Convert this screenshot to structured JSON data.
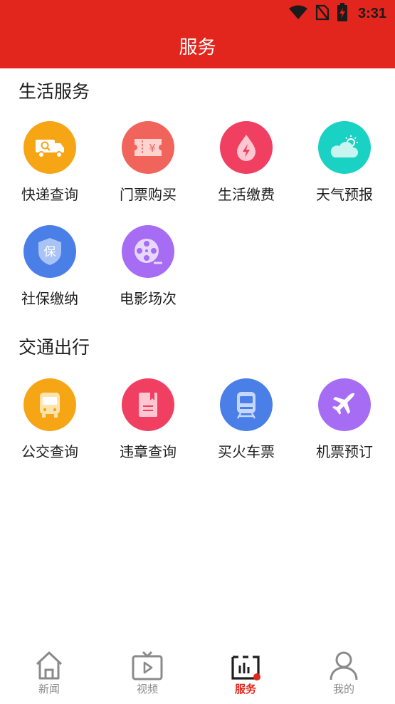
{
  "status_bar": {
    "time": "3:31"
  },
  "header": {
    "title": "服务"
  },
  "sections": [
    {
      "title": "生活服务",
      "items": [
        {
          "label": "快递查询",
          "icon": "truck-search-icon",
          "color": "#f6a515"
        },
        {
          "label": "门票购买",
          "icon": "ticket-icon",
          "color": "#f0645c"
        },
        {
          "label": "生活缴费",
          "icon": "drop-bolt-icon",
          "color": "#f03f61"
        },
        {
          "label": "天气预报",
          "icon": "cloud-sun-icon",
          "color": "#19d2c3"
        },
        {
          "label": "社保缴纳",
          "icon": "shield-icon",
          "color": "#4a7fe8"
        },
        {
          "label": "电影场次",
          "icon": "film-reel-icon",
          "color": "#a66cf4"
        }
      ]
    },
    {
      "title": "交通出行",
      "items": [
        {
          "label": "公交查询",
          "icon": "bus-icon",
          "color": "#f6a515"
        },
        {
          "label": "违章查询",
          "icon": "book-icon",
          "color": "#f03f61"
        },
        {
          "label": "买火车票",
          "icon": "train-icon",
          "color": "#4a7fe8"
        },
        {
          "label": "机票预订",
          "icon": "airplane-icon",
          "color": "#a66cf4"
        }
      ]
    }
  ],
  "tabbar": {
    "tabs": [
      {
        "label": "新闻",
        "icon": "home-icon"
      },
      {
        "label": "视频",
        "icon": "tv-icon"
      },
      {
        "label": "服务",
        "icon": "service-icon",
        "active": true
      },
      {
        "label": "我的",
        "icon": "user-icon"
      }
    ]
  },
  "colors": {
    "brand": "#e3261d",
    "inactive_tab": "#8a8a8a"
  }
}
